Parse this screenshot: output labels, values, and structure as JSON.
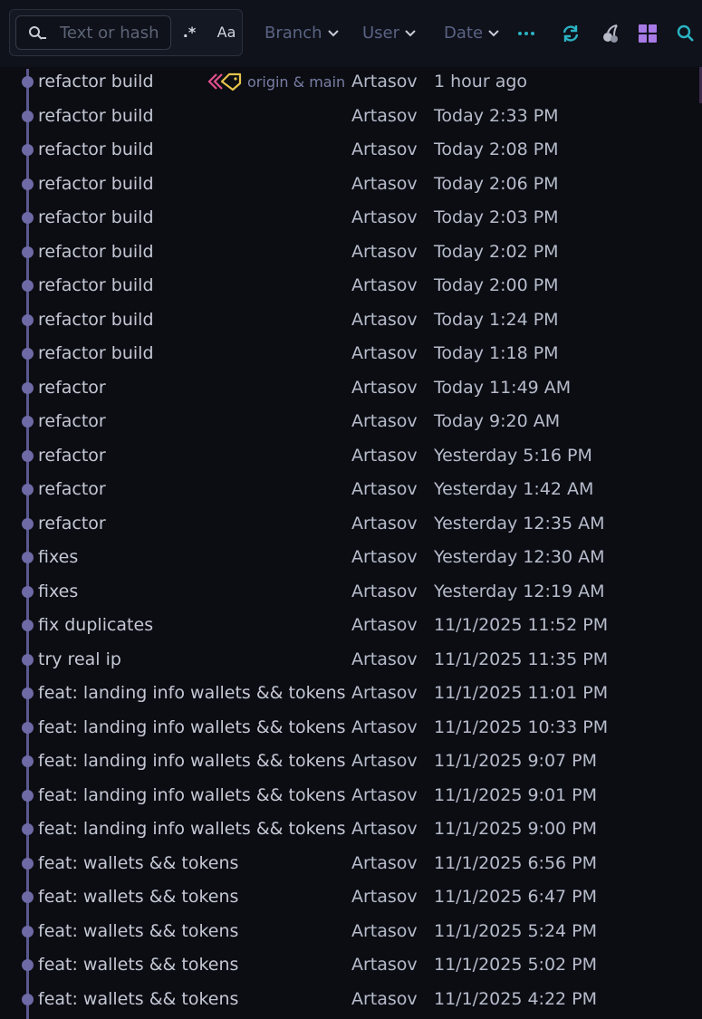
{
  "toolbar": {
    "search_placeholder": "Text or hash",
    "search_value": "",
    "regex_icon": "regex-icon",
    "regex_label": ".*",
    "case_label": "Aa",
    "branch_label": "Branch",
    "user_label": "User",
    "date_label": "Date",
    "more_icon": "more-horizontal-icon",
    "refresh_icon": "refresh-icon",
    "cherry_pick_icon": "cherry-pick-icon",
    "layout_icon": "grid-layout-icon",
    "search_icon": "search-icon"
  },
  "colors": {
    "background": "#0b0d13",
    "toolbar": "#0f121a",
    "graph": "#6e6aa6",
    "refresh": "#2bb3c4",
    "layout": "#a77ae6",
    "tag_pink": "#e04f8a",
    "tag_yellow": "#e5c24a",
    "filter_text": "#5a6384"
  },
  "refs": {
    "label": "origin & main",
    "icons": [
      "remote-branch-icon",
      "branch-tag-icon"
    ]
  },
  "commits": [
    {
      "message": "refactor build",
      "user": "Artasov",
      "date": "1 hour ago"
    },
    {
      "message": "refactor build",
      "user": "Artasov",
      "date": "Today 2:33 PM"
    },
    {
      "message": "refactor build",
      "user": "Artasov",
      "date": "Today 2:08 PM"
    },
    {
      "message": "refactor build",
      "user": "Artasov",
      "date": "Today 2:06 PM"
    },
    {
      "message": "refactor build",
      "user": "Artasov",
      "date": "Today 2:03 PM"
    },
    {
      "message": "refactor build",
      "user": "Artasov",
      "date": "Today 2:02 PM"
    },
    {
      "message": "refactor build",
      "user": "Artasov",
      "date": "Today 2:00 PM"
    },
    {
      "message": "refactor build",
      "user": "Artasov",
      "date": "Today 1:24 PM"
    },
    {
      "message": "refactor build",
      "user": "Artasov",
      "date": "Today 1:18 PM"
    },
    {
      "message": "refactor",
      "user": "Artasov",
      "date": "Today 11:49 AM"
    },
    {
      "message": "refactor",
      "user": "Artasov",
      "date": "Today 9:20 AM"
    },
    {
      "message": "refactor",
      "user": "Artasov",
      "date": "Yesterday 5:16 PM"
    },
    {
      "message": "refactor",
      "user": "Artasov",
      "date": "Yesterday 1:42 AM"
    },
    {
      "message": "refactor",
      "user": "Artasov",
      "date": "Yesterday 12:35 AM"
    },
    {
      "message": "fixes",
      "user": "Artasov",
      "date": "Yesterday 12:30 AM"
    },
    {
      "message": "fixes",
      "user": "Artasov",
      "date": "Yesterday 12:19 AM"
    },
    {
      "message": "fix duplicates",
      "user": "Artasov",
      "date": "11/1/2025 11:52 PM"
    },
    {
      "message": "try real ip",
      "user": "Artasov",
      "date": "11/1/2025 11:35 PM"
    },
    {
      "message": "feat: landing info wallets && tokens",
      "user": "Artasov",
      "date": "11/1/2025 11:01 PM"
    },
    {
      "message": "feat: landing info wallets && tokens",
      "user": "Artasov",
      "date": "11/1/2025 10:33 PM"
    },
    {
      "message": "feat: landing info wallets && tokens",
      "user": "Artasov",
      "date": "11/1/2025 9:07 PM"
    },
    {
      "message": "feat: landing info wallets && tokens",
      "user": "Artasov",
      "date": "11/1/2025 9:01 PM"
    },
    {
      "message": "feat: landing info wallets && tokens",
      "user": "Artasov",
      "date": "11/1/2025 9:00 PM"
    },
    {
      "message": "feat: wallets && tokens",
      "user": "Artasov",
      "date": "11/1/2025 6:56 PM"
    },
    {
      "message": "feat: wallets && tokens",
      "user": "Artasov",
      "date": "11/1/2025 6:47 PM"
    },
    {
      "message": "feat: wallets && tokens",
      "user": "Artasov",
      "date": "11/1/2025 5:24 PM"
    },
    {
      "message": "feat: wallets && tokens",
      "user": "Artasov",
      "date": "11/1/2025 5:02 PM"
    },
    {
      "message": "feat: wallets && tokens",
      "user": "Artasov",
      "date": "11/1/2025 4:22 PM"
    }
  ]
}
